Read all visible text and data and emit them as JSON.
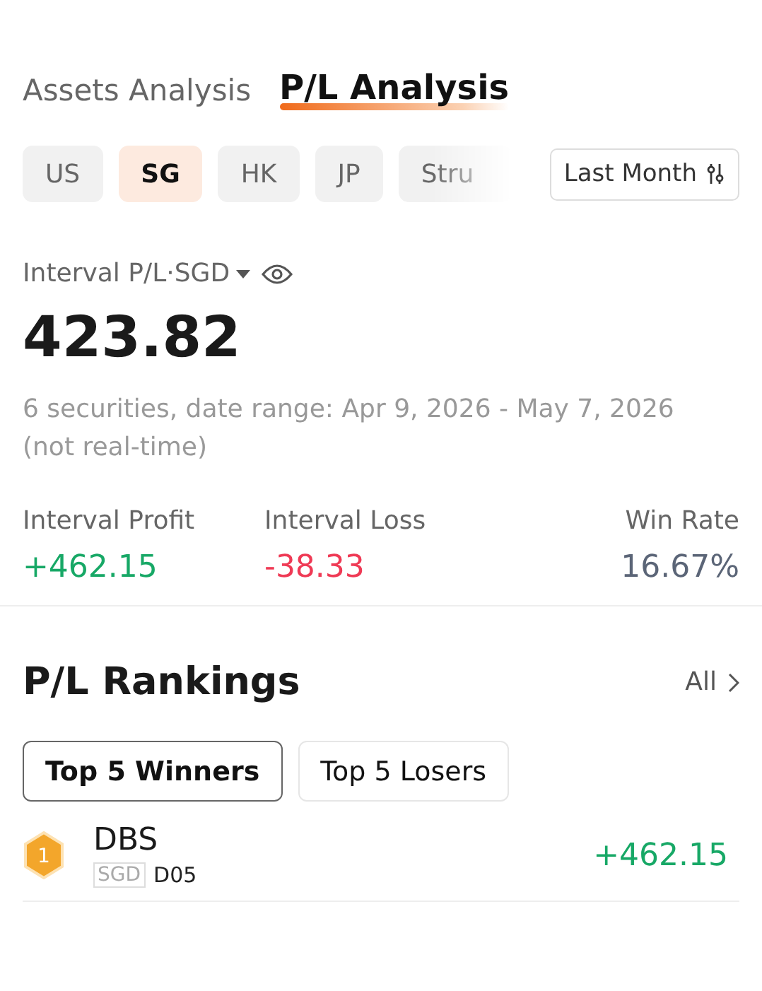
{
  "tabs": [
    {
      "label": "Assets Analysis",
      "selected": false
    },
    {
      "label": "P/L Analysis",
      "selected": true
    }
  ],
  "markets": [
    {
      "label": "US",
      "selected": false
    },
    {
      "label": "SG",
      "selected": true
    },
    {
      "label": "HK",
      "selected": false
    },
    {
      "label": "JP",
      "selected": false
    },
    {
      "label": "Stru",
      "selected": false
    }
  ],
  "period_button": "Last Month",
  "summary": {
    "label": "Interval P/L·SGD",
    "value": "423.82",
    "note": "6 securities, date range: Apr 9, 2026 - May 7, 2026 (not real-time)"
  },
  "stats": [
    {
      "label": "Interval Profit",
      "value": "+462.15",
      "color": "#17a866"
    },
    {
      "label": "Interval Loss",
      "value": "-38.33",
      "color": "#ef3a55"
    },
    {
      "label": "Win Rate",
      "value": "16.67%",
      "color": "#5b6577"
    }
  ],
  "rankings": {
    "title": "P/L Rankings",
    "all_link": "All",
    "toggles": [
      {
        "label": "Top 5 Winners",
        "selected": true
      },
      {
        "label": "Top 5 Losers",
        "selected": false
      }
    ],
    "rows": [
      {
        "rank": "1",
        "name": "DBS",
        "currency": "SGD",
        "code": "D05",
        "value": "+462.15",
        "color": "#17a866"
      }
    ]
  }
}
